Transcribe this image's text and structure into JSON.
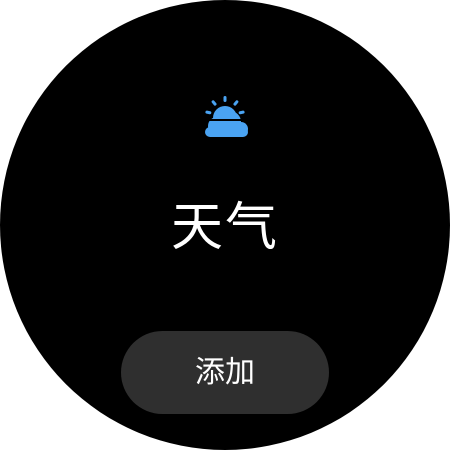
{
  "tile": {
    "icon": "partly-cloudy-icon",
    "title": "天气",
    "add_label": "添加"
  },
  "colors": {
    "background": "#000000",
    "icon_accent": "#4aa3f2",
    "button_background": "#2f2f2f",
    "text": "#ffffff"
  }
}
